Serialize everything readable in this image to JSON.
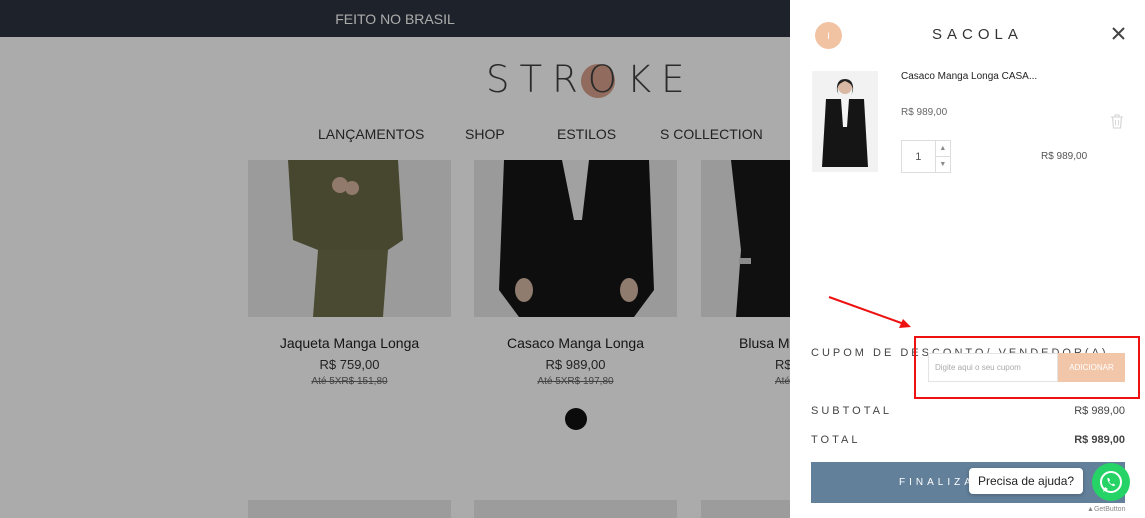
{
  "store": {
    "topbar": "FEITO NO BRASIL",
    "logo": "STROKE",
    "nav": [
      "LANÇAMENTOS",
      "SHOP",
      "ESTILOS",
      "S COLLECTION"
    ],
    "products": [
      {
        "name": "Jaqueta Manga Longa",
        "price": "R$ 759,00",
        "installments": "Até 5XR$ 151,80"
      },
      {
        "name": "Casaco Manga Longa",
        "price": "R$ 989,00",
        "installments": "Até 5XR$ 197,80"
      },
      {
        "name": "Blusa M",
        "price": "R$",
        "installments": "Até"
      }
    ]
  },
  "cart": {
    "avatar": "I",
    "title": "SACOLA",
    "item": {
      "name": "Casaco Manga Longa CASA...",
      "unit_price": "R$ 989,00",
      "quantity": "1",
      "total": "R$ 989,00"
    },
    "coupon": {
      "label": "CUPOM DE DESCONTO/ VENDEDOR(A)",
      "placeholder": "Digite aqui o seu cupom",
      "button": "ADICIONAR"
    },
    "subtotal_label": "SUBTOTAL",
    "subtotal": "R$ 989,00",
    "total_label": "TOTAL",
    "total": "R$ 989,00",
    "checkout": "FINALIZAR"
  },
  "widget": {
    "help": "Precisa de ajuda?",
    "brand": "GetButton"
  },
  "colors": {
    "topbar": "#2e3440",
    "accent": "#f2c6a9",
    "checkout": "#62809a",
    "annotation": "#ee1111",
    "whatsapp": "#25d366"
  },
  "icons": [
    "close-icon",
    "trash-icon",
    "chevron-up-icon",
    "chevron-down-icon",
    "whatsapp-icon"
  ]
}
